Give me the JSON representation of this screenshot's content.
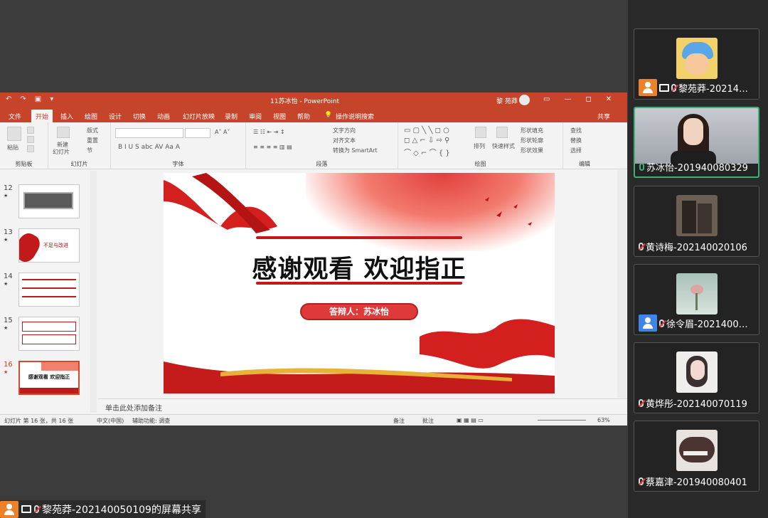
{
  "ppt": {
    "title": "11苏冰怡 - PowerPoint",
    "user": "黎 苑莽",
    "quick_access": [
      "↶",
      "↷",
      "▣",
      "▾"
    ],
    "window_buttons": [
      "▭",
      "—",
      "◻",
      "✕"
    ],
    "tabs": [
      "文件",
      "开始",
      "插入",
      "绘图",
      "设计",
      "切换",
      "动画",
      "幻灯片放映",
      "录制",
      "审阅",
      "视图",
      "帮助",
      "操作说明搜索"
    ],
    "active_tab": "开始",
    "share": "共享",
    "ribbon": {
      "paste": "粘贴",
      "clipboard": "剪贴板",
      "new_slide_1": "新建",
      "new_slide_2": "幻灯片",
      "layout": "版式",
      "reset": "重置",
      "section": "节",
      "slides_group": "幻灯片",
      "font_group": "字体",
      "font_buttons": "B  I  U  S  abc  AV  Aa  A",
      "text_direction": "文字方向",
      "align_text": "对齐文本",
      "smartart": "转换为 SmartArt",
      "paragraph_group": "段落",
      "arrange": "排列",
      "quick_styles": "快速样式",
      "shape_fill": "形状填充",
      "shape_outline": "形状轮廓",
      "shape_effects": "形状效果",
      "drawing_group": "绘图",
      "find": "查找",
      "replace": "替换",
      "select": "选择",
      "editing_group": "编辑"
    },
    "thumbs": [
      {
        "num": "12",
        "star": "★"
      },
      {
        "num": "13",
        "star": "★"
      },
      {
        "num": "14",
        "star": "★"
      },
      {
        "num": "15",
        "star": "★"
      },
      {
        "num": "16",
        "star": "★"
      }
    ],
    "thumb13_text": "不足与改进",
    "thumb16_text": "感谢观看 欢迎指正",
    "slide": {
      "title": "感谢观看 欢迎指正",
      "presenter": "答辩人：苏冰怡"
    },
    "notes_placeholder": "单击此处添加备注",
    "status": {
      "slide_count": "幻灯片 第 16 张，共 16 张",
      "language": "中文(中国)",
      "accessibility": "辅助功能: 调查",
      "notes": "备注",
      "comments": "批注",
      "zoom": "63%"
    }
  },
  "participants": [
    {
      "name": "黎苑莽-20214…",
      "badge": "orange",
      "screen": true,
      "mic": "muted",
      "active": false
    },
    {
      "name": "苏冰怡-201940080329",
      "badge": "",
      "screen": false,
      "mic": "on",
      "active": true
    },
    {
      "name": "黄诗梅-202140020106",
      "badge": "",
      "screen": false,
      "mic": "muted",
      "active": false
    },
    {
      "name": "徐令眉-2021400…",
      "badge": "blue",
      "screen": false,
      "mic": "muted",
      "active": false
    },
    {
      "name": "黄烨彤-202140070119",
      "badge": "",
      "screen": false,
      "mic": "muted",
      "active": false
    },
    {
      "name": "蔡嘉津-201940080401",
      "badge": "",
      "screen": false,
      "mic": "muted",
      "active": false
    }
  ],
  "share_label": "黎苑莽-202140050109的屏幕共享",
  "colors": {
    "accent": "#c5442a",
    "talking": "#3fb07a"
  }
}
